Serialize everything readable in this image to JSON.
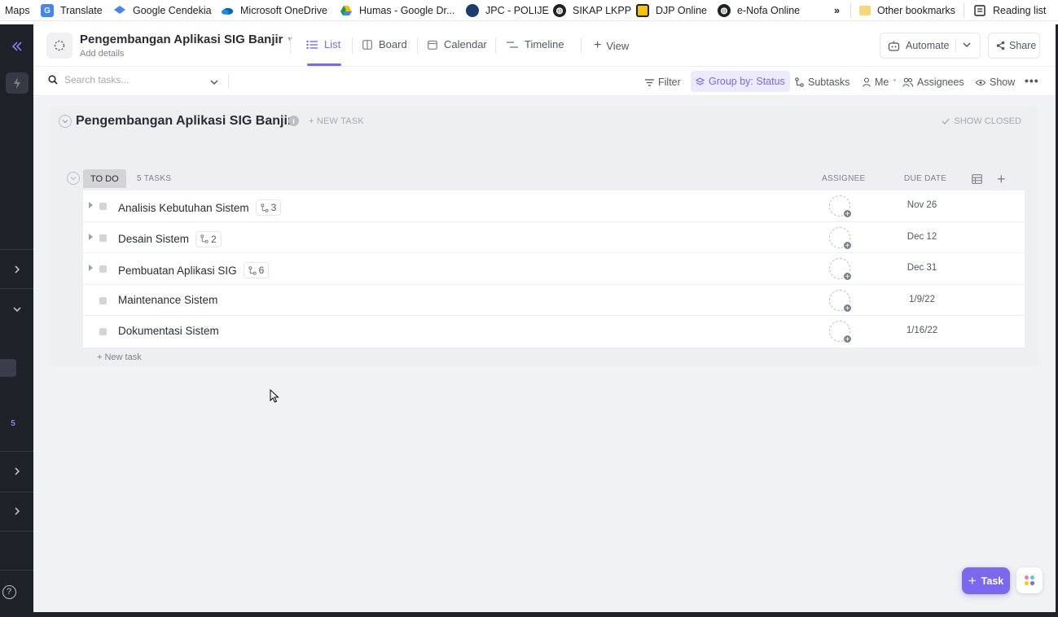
{
  "bookmarks": [
    {
      "label": "Maps",
      "icon": "none"
    },
    {
      "label": "Translate",
      "icon": "translate-icon"
    },
    {
      "label": "Google Cendekia",
      "icon": "scholar-icon"
    },
    {
      "label": "Microsoft OneDrive",
      "icon": "onedrive-icon"
    },
    {
      "label": "Humas - Google Dr...",
      "icon": "drive-icon"
    },
    {
      "label": "JPC - POLIJE",
      "icon": "site-icon"
    },
    {
      "label": "SIKAP LKPP",
      "icon": "globe-icon"
    },
    {
      "label": "DJP Online",
      "icon": "site-icon"
    },
    {
      "label": "e-Nofa Online",
      "icon": "globe-icon"
    }
  ],
  "bookmarks_overflow": "»",
  "bookmarks_other": "Other bookmarks",
  "reading_list": "Reading list",
  "header": {
    "title": "Pengembangan Aplikasi SIG Banjir",
    "subtitle": "Add details",
    "tabs": [
      {
        "label": "List",
        "icon": "list-icon",
        "active": true
      },
      {
        "label": "Board",
        "icon": "board-icon",
        "active": false
      },
      {
        "label": "Calendar",
        "icon": "calendar-icon",
        "active": false
      },
      {
        "label": "Timeline",
        "icon": "timeline-icon",
        "active": false
      }
    ],
    "add_view": "View",
    "automate": "Automate",
    "share": "Share"
  },
  "toolbar": {
    "search_placeholder": "Search tasks...",
    "filter": "Filter",
    "group_by": "Group by: Status",
    "subtasks": "Subtasks",
    "me": "Me",
    "assignees": "Assignees",
    "show": "Show"
  },
  "list": {
    "title": "Pengembangan Aplikasi SIG Banjir",
    "new_task_link": "+ NEW TASK",
    "show_closed": "SHOW CLOSED",
    "group": {
      "status": "TO DO",
      "count": "5 TASKS",
      "col_assignee": "ASSIGNEE",
      "col_due": "DUE DATE"
    },
    "tasks": [
      {
        "name": "Analisis Kebutuhan Sistem",
        "subtasks": "3",
        "due": "Nov 26"
      },
      {
        "name": "Desain Sistem",
        "subtasks": "2",
        "due": "Dec 12"
      },
      {
        "name": "Pembuatan Aplikasi SIG",
        "subtasks": "6",
        "due": "Dec 31"
      },
      {
        "name": "Maintenance Sistem",
        "subtasks": "",
        "due": "1/9/22"
      },
      {
        "name": "Dokumentasi Sistem",
        "subtasks": "",
        "due": "1/16/22"
      }
    ],
    "new_task_bottom": "+ New task"
  },
  "rail": {
    "badge_count": "5"
  },
  "fab": {
    "label": "Task"
  },
  "colors": {
    "accent": "#7b68ee",
    "rail": "#1f2128",
    "status_todo": "#d3d4d6"
  }
}
